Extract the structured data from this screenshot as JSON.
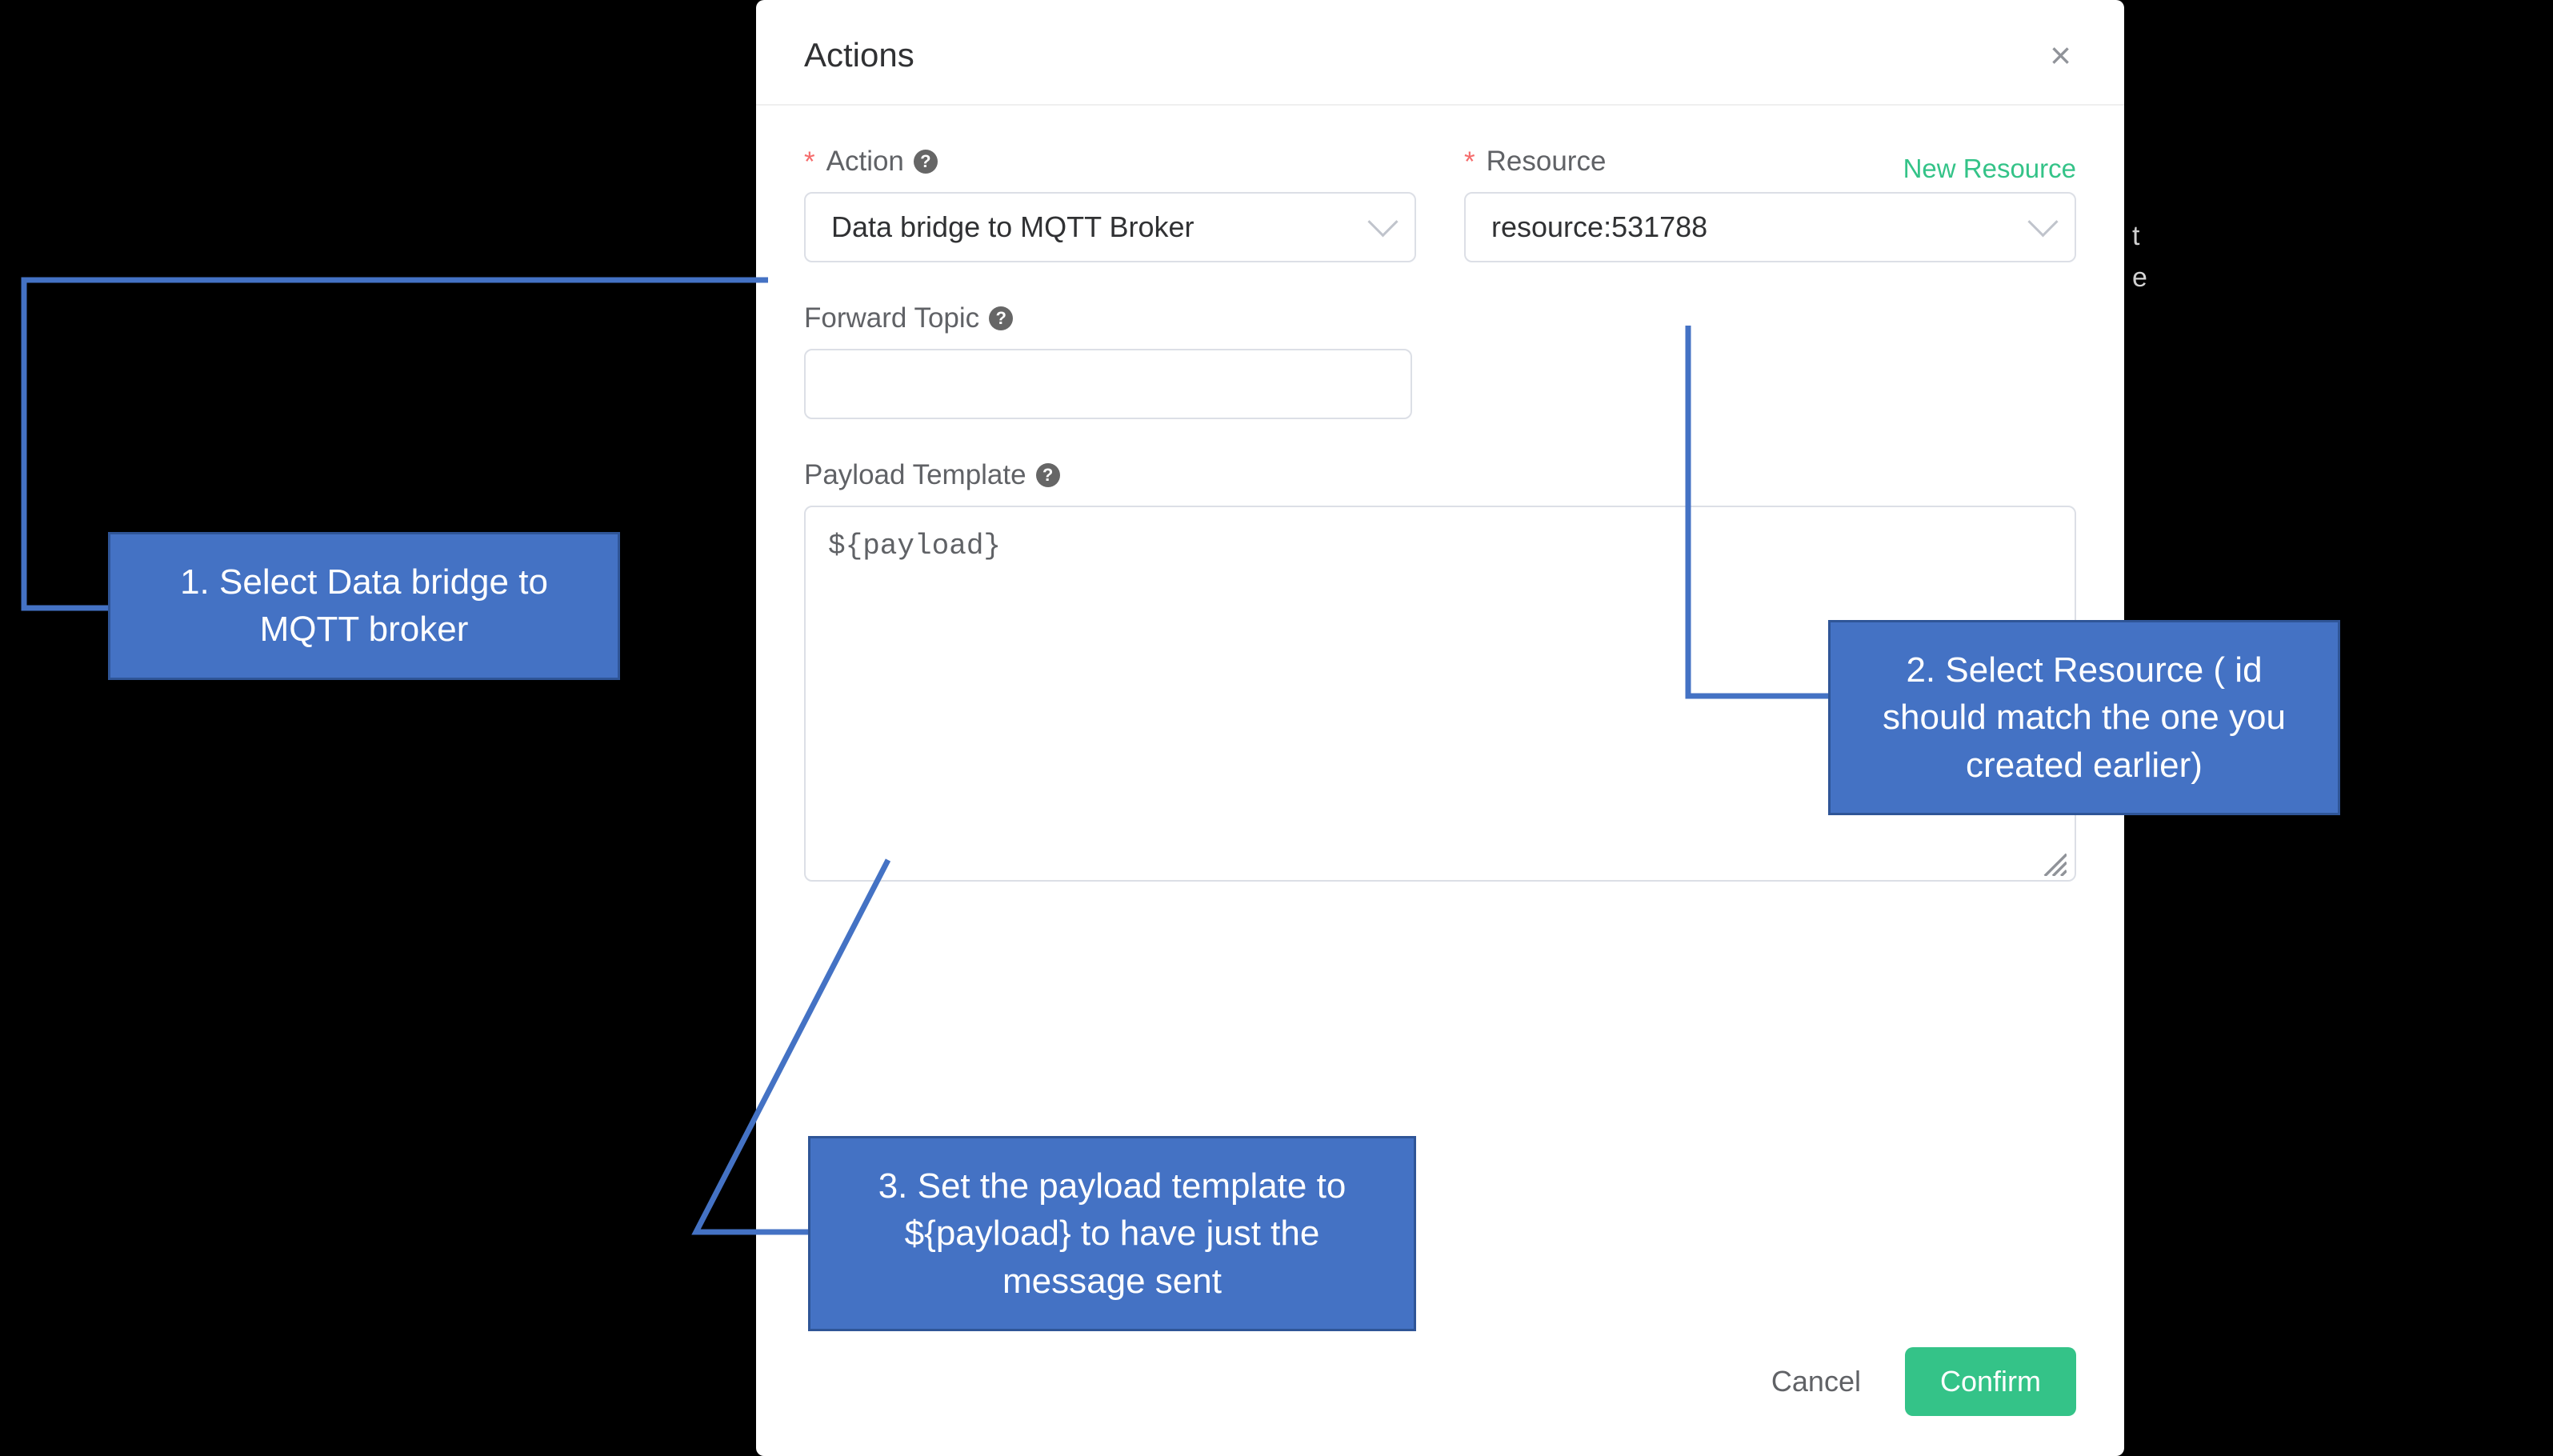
{
  "modal": {
    "title": "Actions",
    "fields": {
      "action": {
        "label": "Action",
        "value": "Data bridge to MQTT Broker"
      },
      "resource": {
        "label": "Resource",
        "new_link": "New Resource",
        "value": "resource:531788"
      },
      "forward_topic": {
        "label": "Forward Topic",
        "value": ""
      },
      "payload_template": {
        "label": "Payload Template",
        "value": "${payload}"
      }
    },
    "buttons": {
      "cancel": "Cancel",
      "confirm": "Confirm"
    }
  },
  "annotations": {
    "step1": "1. Select Data bridge to MQTT broker",
    "step2": "2. Select Resource ( id should match the one you created earlier)",
    "step3": "3. Set the payload template to ${payload} to have just the message sent"
  }
}
